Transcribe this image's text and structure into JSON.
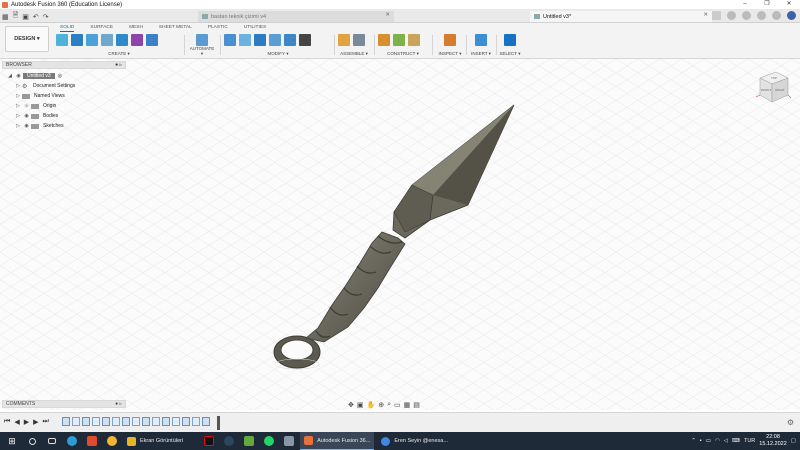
{
  "window": {
    "title": "Autodesk Fusion 360 (Education License)",
    "controls": [
      "–",
      "❐",
      "✕"
    ]
  },
  "tabs": {
    "inactive": {
      "label": "bastan teknik çizimi v4"
    },
    "active": {
      "label": "Untitled v3*"
    }
  },
  "toolbar": {
    "workspace": "DESIGN ▾",
    "workspace_tabs": [
      "SOLID",
      "SURFACE",
      "MESH",
      "SHEET METAL",
      "PLASTIC",
      "UTILITIES"
    ],
    "groups": {
      "create": "CREATE ▾",
      "automate": "AUTOMATE ▾",
      "modify": "MODIFY ▾",
      "assemble": "ASSEMBLE ▾",
      "construct": "CONSTRUCT ▾",
      "inspect": "INSPECT ▾",
      "insert": "INSERT ▾",
      "select": "SELECT ▾"
    }
  },
  "browser": {
    "header": "BROWSER",
    "root": "Untitled v3",
    "items": [
      {
        "label": "Document Settings",
        "type": "gear"
      },
      {
        "label": "Named Views",
        "type": "folder"
      },
      {
        "label": "Origin",
        "type": "folder"
      },
      {
        "label": "Bodies",
        "type": "folder"
      },
      {
        "label": "Sketches",
        "type": "folder"
      }
    ]
  },
  "viewcube": {
    "top": "TOP",
    "front": "FRONT",
    "right": "RIGHT"
  },
  "comments": {
    "header": "COMMENTS"
  },
  "taskbar": {
    "apps": [
      {
        "label": "Ekran Görüntüleri",
        "color": "#e8b526"
      },
      {
        "label": "Autodesk Fusion 36...",
        "color": "#e8703a"
      },
      {
        "label": "Eren Seyin @enesa...",
        "color": "#3f88e0"
      }
    ],
    "language": "TUR",
    "time": "22:08",
    "date": "15.12.2022"
  },
  "colors": {
    "accent": "#0b6fb5",
    "model": "#6e6c5f",
    "taskbar": "#1f2a38"
  }
}
